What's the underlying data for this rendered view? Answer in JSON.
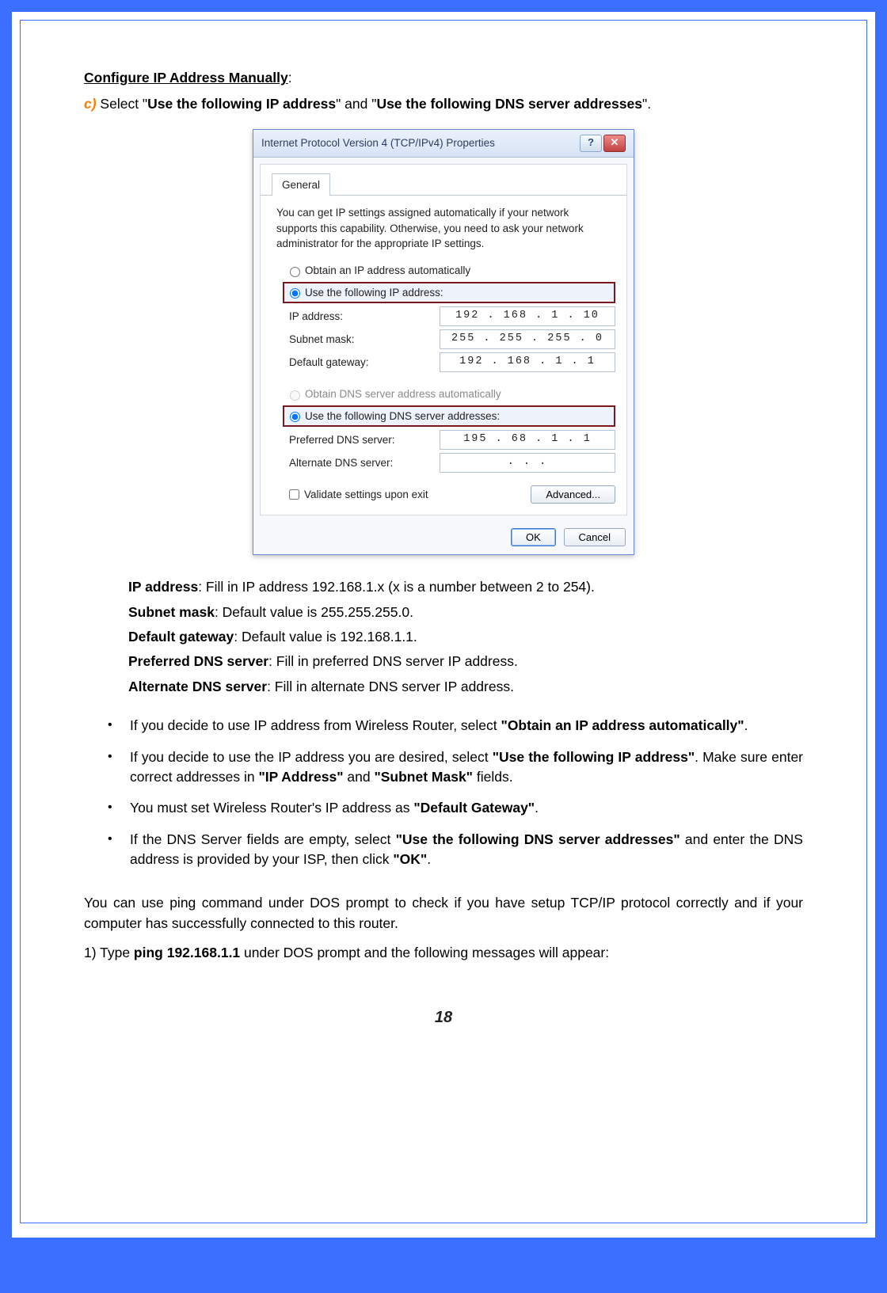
{
  "heading": "Configure IP Address Manually",
  "heading_suffix": ":",
  "step_prefix": "c)",
  "step_text_1": " Select \"",
  "step_bold_1": "Use the following IP address",
  "step_text_2": "\" and \"",
  "step_bold_2": "Use the following DNS server addresses",
  "step_text_3": "\".",
  "dialog": {
    "title": "Internet Protocol Version 4 (TCP/IPv4) Properties",
    "help_glyph": "?",
    "close_glyph": "✕",
    "tab": "General",
    "description": "You can get IP settings assigned automatically if your network supports this capability. Otherwise, you need to ask your network administrator for the appropriate IP settings.",
    "radio_auto_ip": "Obtain an IP address automatically",
    "radio_static_ip": "Use the following IP address:",
    "label_ip": "IP address:",
    "label_mask": "Subnet mask:",
    "label_gw": "Default gateway:",
    "value_ip": "192 . 168 .  1  . 10",
    "value_mask": "255 . 255 . 255 .  0",
    "value_gw": "192 . 168 .  1  .  1",
    "radio_auto_dns": "Obtain DNS server address automatically",
    "radio_static_dns": "Use the following DNS server addresses:",
    "label_pref": "Preferred DNS server:",
    "label_alt": "Alternate DNS server:",
    "value_pref": "195 . 68 .  1  .  1",
    "value_alt": ".      .      .",
    "checkbox": "Validate settings upon exit",
    "btn_adv": "Advanced...",
    "btn_ok": "OK",
    "btn_cancel": "Cancel"
  },
  "defs": {
    "ip_b": "IP address",
    "ip_t": ": Fill in IP address 192.168.1.x (x is a number between 2 to 254).",
    "mask_b": "Subnet mask",
    "mask_t": ": Default value is 255.255.255.0.",
    "gw_b": "Default gateway",
    "gw_t": ": Default value is 192.168.1.1.",
    "pref_b": "Preferred DNS server",
    "pref_t": ": Fill in preferred DNS server IP address.",
    "alt_b": "Alternate DNS server",
    "alt_t": ": Fill in alternate DNS server IP address."
  },
  "bullets": {
    "b1a": "If you decide to use IP address from Wireless Router, select ",
    "b1b": "\"Obtain an IP address automatically\"",
    "b1c": ".",
    "b2a": "If you decide to use the IP address you are desired, select ",
    "b2b": "\"Use the following IP address\"",
    "b2c": ". Make sure enter correct addresses in ",
    "b2d": "\"IP Address\"",
    "b2e": " and ",
    "b2f": "\"Subnet Mask\"",
    "b2g": " fields.",
    "b3a": "You must set Wireless Router's IP address as ",
    "b3b": "\"Default Gateway\"",
    "b3c": ".",
    "b4a": "If the DNS Server fields are empty, select ",
    "b4b": "\"Use the following DNS server addresses\"",
    "b4c": " and enter the DNS address is provided by your ISP, then click ",
    "b4d": "\"OK\"",
    "b4e": "."
  },
  "closing1": "You can use ping command under DOS prompt to check if you have setup TCP/IP protocol correctly and if your computer has successfully connected to this router.",
  "closing2a": "1)  Type ",
  "closing2b": "ping 192.168.1.1",
  "closing2c": " under DOS prompt and the following messages will appear:",
  "page_number": "18"
}
